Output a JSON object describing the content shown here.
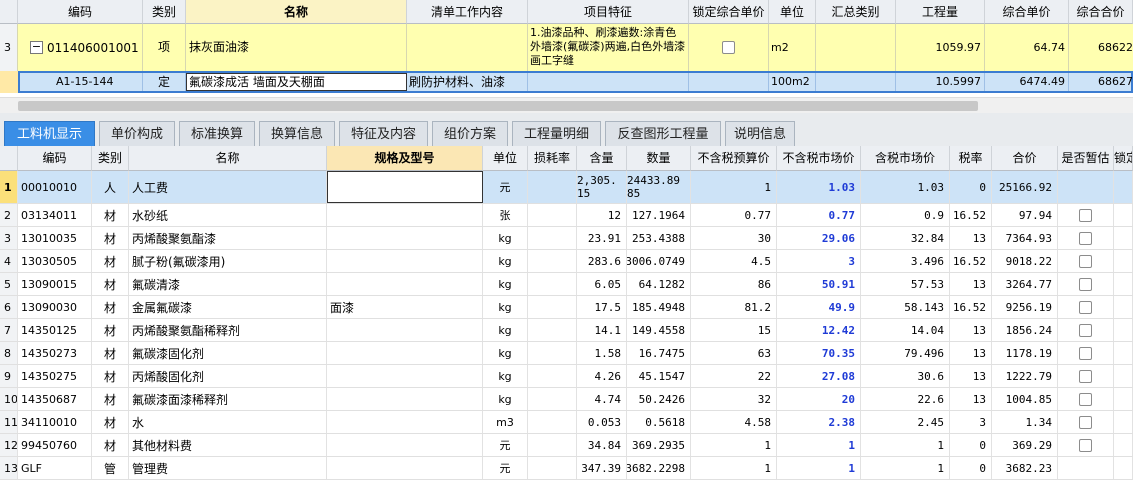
{
  "top": {
    "headers": [
      "编码",
      "类别",
      "名称",
      "清单工作内容",
      "项目特征",
      "锁定综合单价",
      "单位",
      "汇总类别",
      "工程量",
      "综合单价",
      "综合合价"
    ],
    "row1": {
      "num": "3",
      "toggle": "−",
      "code": "011406001001",
      "type": "项",
      "name": "抹灰面油漆",
      "work": "",
      "feature": "1.油漆品种、刷漆遍数:涂青色外墙漆(氟碳漆)两遍,白色外墙漆画工字缝",
      "unit": "m2",
      "summary": "",
      "qty": "1059.97",
      "price": "64.74",
      "total": "68622"
    },
    "row2": {
      "code": "A1-15-144",
      "type": "定",
      "name": "氟碳漆成活 墙面及天棚面",
      "work": "刷防护材料、油漆",
      "feature": "",
      "unit": "100m2",
      "summary": "",
      "qty": "10.5997",
      "price": "6474.49",
      "total": "68627"
    }
  },
  "tabs": [
    "工料机显示",
    "单价构成",
    "标准换算",
    "换算信息",
    "特征及内容",
    "组价方案",
    "工程量明细",
    "反查图形工程量",
    "说明信息"
  ],
  "bottom": {
    "headers": [
      "编码",
      "类别",
      "名称",
      "规格及型号",
      "单位",
      "损耗率",
      "含量",
      "数量",
      "不含税预算价",
      "不含税市场价",
      "含税市场价",
      "税率",
      "合价",
      "是否暂估",
      "锁定"
    ],
    "rows": [
      {
        "n": "1",
        "code": "00010010",
        "type": "人",
        "name": "人工费",
        "spec": "",
        "unit": "元",
        "loss": "",
        "content": "2,305.15",
        "qty": "24433.8985",
        "budget": "1",
        "market": "1.03",
        "tax_market": "1.03",
        "rate": "0",
        "total": "25166.92",
        "cb": false
      },
      {
        "n": "2",
        "code": "03134011",
        "type": "材",
        "name": "水砂纸",
        "spec": "",
        "unit": "张",
        "loss": "",
        "content": "12",
        "qty": "127.1964",
        "budget": "0.77",
        "market": "0.77",
        "tax_market": "0.9",
        "rate": "16.52",
        "total": "97.94",
        "cb": true
      },
      {
        "n": "3",
        "code": "13010035",
        "type": "材",
        "name": "丙烯酸聚氨酯漆",
        "spec": "",
        "unit": "kg",
        "loss": "",
        "content": "23.91",
        "qty": "253.4388",
        "budget": "30",
        "market": "29.06",
        "tax_market": "32.84",
        "rate": "13",
        "total": "7364.93",
        "cb": true
      },
      {
        "n": "4",
        "code": "13030505",
        "type": "材",
        "name": "腻子粉(氟碳漆用)",
        "spec": "",
        "unit": "kg",
        "loss": "",
        "content": "283.6",
        "qty": "3006.0749",
        "budget": "4.5",
        "market": "3",
        "tax_market": "3.496",
        "rate": "16.52",
        "total": "9018.22",
        "cb": true
      },
      {
        "n": "5",
        "code": "13090015",
        "type": "材",
        "name": "氟碳清漆",
        "spec": "",
        "unit": "kg",
        "loss": "",
        "content": "6.05",
        "qty": "64.1282",
        "budget": "86",
        "market": "50.91",
        "tax_market": "57.53",
        "rate": "13",
        "total": "3264.77",
        "cb": true
      },
      {
        "n": "6",
        "code": "13090030",
        "type": "材",
        "name": "金属氟碳漆",
        "spec": "面漆",
        "unit": "kg",
        "loss": "",
        "content": "17.5",
        "qty": "185.4948",
        "budget": "81.2",
        "market": "49.9",
        "tax_market": "58.143",
        "rate": "16.52",
        "total": "9256.19",
        "cb": true
      },
      {
        "n": "7",
        "code": "14350125",
        "type": "材",
        "name": "丙烯酸聚氨酯稀释剂",
        "spec": "",
        "unit": "kg",
        "loss": "",
        "content": "14.1",
        "qty": "149.4558",
        "budget": "15",
        "market": "12.42",
        "tax_market": "14.04",
        "rate": "13",
        "total": "1856.24",
        "cb": true
      },
      {
        "n": "8",
        "code": "14350273",
        "type": "材",
        "name": "氟碳漆固化剂",
        "spec": "",
        "unit": "kg",
        "loss": "",
        "content": "1.58",
        "qty": "16.7475",
        "budget": "63",
        "market": "70.35",
        "tax_market": "79.496",
        "rate": "13",
        "total": "1178.19",
        "cb": true
      },
      {
        "n": "9",
        "code": "14350275",
        "type": "材",
        "name": "丙烯酸固化剂",
        "spec": "",
        "unit": "kg",
        "loss": "",
        "content": "4.26",
        "qty": "45.1547",
        "budget": "22",
        "market": "27.08",
        "tax_market": "30.6",
        "rate": "13",
        "total": "1222.79",
        "cb": true
      },
      {
        "n": "10",
        "code": "14350687",
        "type": "材",
        "name": "氟碳漆面漆稀释剂",
        "spec": "",
        "unit": "kg",
        "loss": "",
        "content": "4.74",
        "qty": "50.2426",
        "budget": "32",
        "market": "20",
        "tax_market": "22.6",
        "rate": "13",
        "total": "1004.85",
        "cb": true
      },
      {
        "n": "11",
        "code": "34110010",
        "type": "材",
        "name": "水",
        "spec": "",
        "unit": "m3",
        "loss": "",
        "content": "0.053",
        "qty": "0.5618",
        "budget": "4.58",
        "market": "2.38",
        "tax_market": "2.45",
        "rate": "3",
        "total": "1.34",
        "cb": true
      },
      {
        "n": "12",
        "code": "99450760",
        "type": "材",
        "name": "其他材料费",
        "spec": "",
        "unit": "元",
        "loss": "",
        "content": "34.84",
        "qty": "369.2935",
        "budget": "1",
        "market": "1",
        "tax_market": "1",
        "rate": "0",
        "total": "369.29",
        "cb": true
      },
      {
        "n": "13",
        "code": "GLF",
        "type": "管",
        "name": "管理费",
        "spec": "",
        "unit": "元",
        "loss": "",
        "content": "347.39",
        "qty": "3682.2298",
        "budget": "1",
        "market": "1",
        "tax_market": "1",
        "rate": "0",
        "total": "3682.23",
        "cb": false
      }
    ]
  }
}
